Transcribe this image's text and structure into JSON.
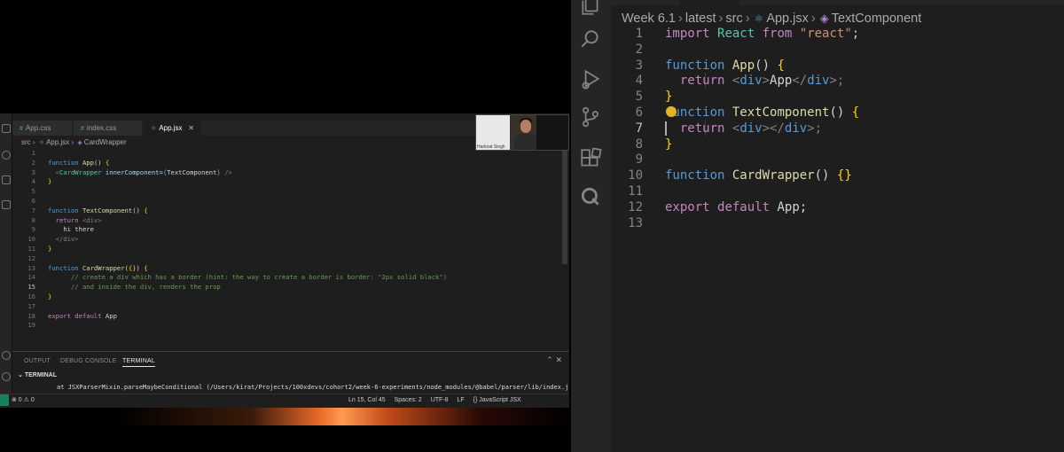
{
  "left_video": {
    "tabs": [
      {
        "label": "App.css",
        "icon": "hash-icon"
      },
      {
        "label": "index.css",
        "icon": "hash-icon"
      },
      {
        "label": "App.jsx",
        "icon": "react-icon",
        "active": true
      }
    ],
    "breadcrumb": {
      "p1": "src",
      "p2": "App.jsx",
      "p3": "CardWrapper"
    },
    "code": [
      {
        "n": "1"
      },
      {
        "n": "2",
        "t": [
          "function",
          " ",
          "App",
          "()",
          " ",
          "{"
        ]
      },
      {
        "n": "3",
        "t": [
          "<",
          "CardWrapper",
          " ",
          "innerComponent",
          "=",
          "{",
          "TextComponent",
          "}",
          " />"
        ]
      },
      {
        "n": "4",
        "t": [
          "}"
        ]
      },
      {
        "n": "5"
      },
      {
        "n": "6"
      },
      {
        "n": "7",
        "t": [
          "function",
          " ",
          "TextComponent",
          "()",
          " ",
          "{"
        ]
      },
      {
        "n": "8",
        "t": [
          "return",
          " ",
          "<div>"
        ]
      },
      {
        "n": "9",
        "t": [
          "hi there"
        ]
      },
      {
        "n": "10",
        "t": [
          "</div>"
        ]
      },
      {
        "n": "11",
        "t": [
          "}"
        ]
      },
      {
        "n": "12"
      },
      {
        "n": "13",
        "t": [
          "function",
          " ",
          "CardWrapper",
          "(",
          "{",
          "}",
          ")",
          " ",
          "{"
        ]
      },
      {
        "n": "14",
        "t": [
          "// create a div which has a border (hint: the way to create a border is border: \"2px solid black\")"
        ]
      },
      {
        "n": "15",
        "t": [
          "// and inside the div, renders the prop"
        ]
      },
      {
        "n": "16",
        "t": [
          "}"
        ]
      },
      {
        "n": "17"
      },
      {
        "n": "18",
        "t": [
          "export",
          " ",
          "default",
          " ",
          "App"
        ]
      },
      {
        "n": "19"
      }
    ],
    "panel_tabs": [
      "OUTPUT",
      "DEBUG CONSOLE",
      "TERMINAL"
    ],
    "terminal_header": "TERMINAL",
    "terminal_line": "at JSXParserMixin.parseMaybeConditional (/Users/kirat/Projects/100xdevs/cohort2/week-6-experiments/node_modules/@babel/parser/lib/index.js",
    "status_left": "⊗ 0 ⚠ 0",
    "status_right": [
      "Ln 15, Col 45",
      "Spaces: 2",
      "UTF-8",
      "LF",
      "{} JavaScript JSX"
    ],
    "webcam_label": "Harkirat Singh"
  },
  "editor": {
    "breadcrumb": [
      "Week 6.1",
      "latest",
      "src",
      "App.jsx",
      "TextComponent"
    ],
    "code": [
      {
        "n": "1",
        "t": [
          "import",
          " ",
          "React",
          " ",
          "from",
          " ",
          "\"react\"",
          ";"
        ]
      },
      {
        "n": "2"
      },
      {
        "n": "3",
        "t": [
          "function",
          " ",
          "App",
          "()",
          " ",
          "{"
        ]
      },
      {
        "n": "4",
        "t": [
          "  ",
          "return",
          " ",
          "<",
          "div",
          ">",
          "App",
          "</",
          "div",
          ">;"
        ]
      },
      {
        "n": "5",
        "t": [
          "}"
        ]
      },
      {
        "n": "6",
        "t": [
          "function",
          " ",
          "TextComponent",
          "()",
          " ",
          "{"
        ]
      },
      {
        "n": "7",
        "t": [
          "  ",
          "return",
          " ",
          "<",
          "div",
          "></",
          "div",
          ">;"
        ]
      },
      {
        "n": "8",
        "t": [
          "}"
        ]
      },
      {
        "n": "9"
      },
      {
        "n": "10",
        "t": [
          "function",
          " ",
          "CardWrapper",
          "()",
          " ",
          "{}"
        ]
      },
      {
        "n": "11"
      },
      {
        "n": "12",
        "t": [
          "export",
          " ",
          "default",
          " ",
          "App",
          ";"
        ]
      },
      {
        "n": "13"
      }
    ],
    "active_line": "7"
  },
  "activity_bar": [
    "files-icon",
    "search-icon",
    "run-debug-icon",
    "source-control-icon",
    "extensions-icon",
    "remote-icon"
  ]
}
